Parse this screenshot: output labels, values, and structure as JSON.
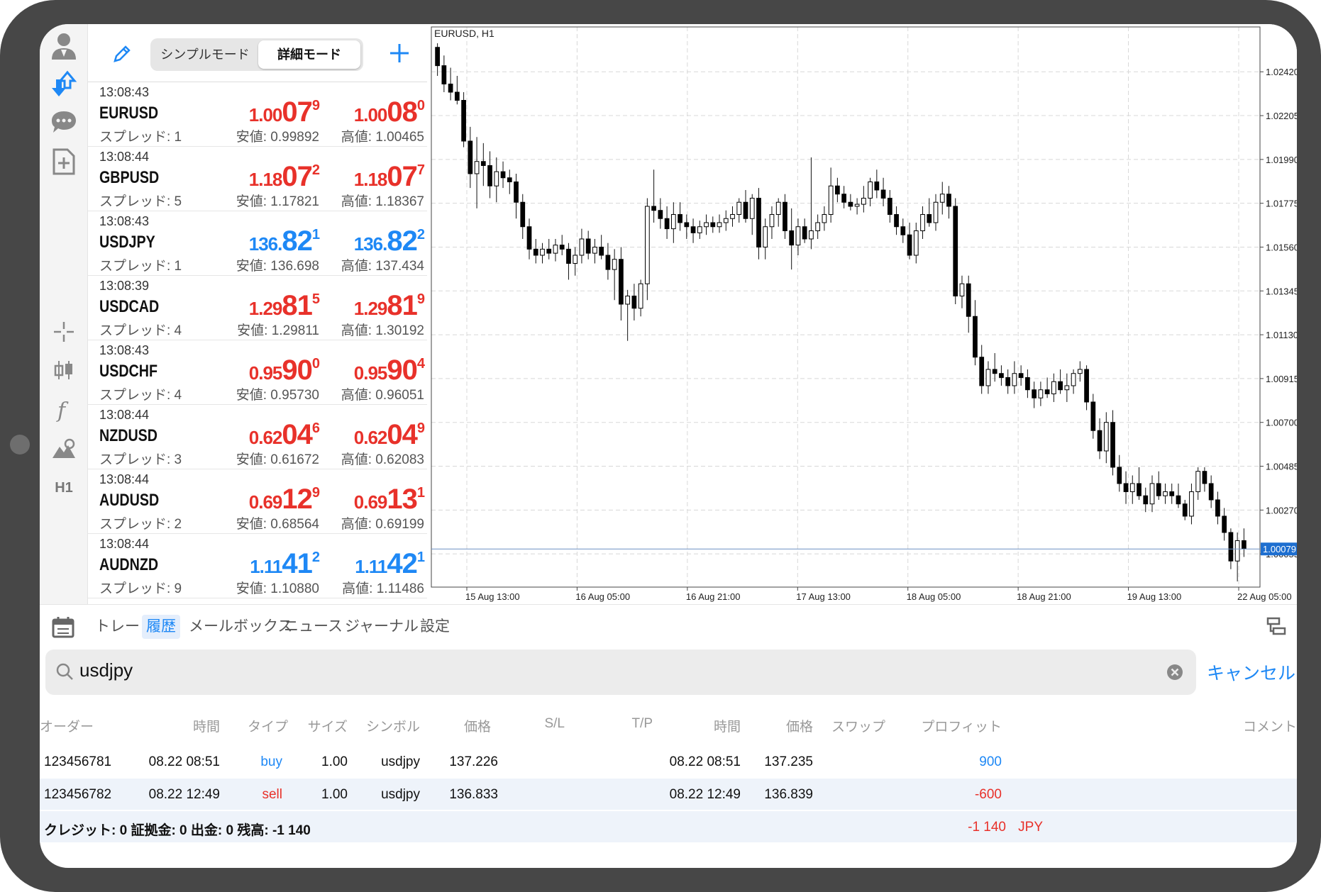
{
  "header": {
    "mode_simple": "シンプルモード",
    "mode_detail": "詳細モード"
  },
  "quotes": [
    {
      "time": "13:08:43",
      "symbol": "EURUSD",
      "spread": "スプレッド: 1",
      "bid": {
        "s": "1.00",
        "b": "07",
        "p": "9"
      },
      "ask": {
        "s": "1.00",
        "b": "08",
        "p": "0"
      },
      "color": "red",
      "low": "安値: 0.99892",
      "high": "高値: 1.00465"
    },
    {
      "time": "13:08:44",
      "symbol": "GBPUSD",
      "spread": "スプレッド: 5",
      "bid": {
        "s": "1.18",
        "b": "07",
        "p": "2"
      },
      "ask": {
        "s": "1.18",
        "b": "07",
        "p": "7"
      },
      "color": "red",
      "low": "安値: 1.17821",
      "high": "高値: 1.18367"
    },
    {
      "time": "13:08:43",
      "symbol": "USDJPY",
      "spread": "スプレッド: 1",
      "bid": {
        "s": "136.",
        "b": "82",
        "p": "1"
      },
      "ask": {
        "s": "136.",
        "b": "82",
        "p": "2"
      },
      "color": "blue",
      "low": "安値: 136.698",
      "high": "高値: 137.434"
    },
    {
      "time": "13:08:39",
      "symbol": "USDCAD",
      "spread": "スプレッド: 4",
      "bid": {
        "s": "1.29",
        "b": "81",
        "p": "5"
      },
      "ask": {
        "s": "1.29",
        "b": "81",
        "p": "9"
      },
      "color": "red",
      "low": "安値: 1.29811",
      "high": "高値: 1.30192"
    },
    {
      "time": "13:08:43",
      "symbol": "USDCHF",
      "spread": "スプレッド: 4",
      "bid": {
        "s": "0.95",
        "b": "90",
        "p": "0"
      },
      "ask": {
        "s": "0.95",
        "b": "90",
        "p": "4"
      },
      "color": "red",
      "low": "安値: 0.95730",
      "high": "高値: 0.96051"
    },
    {
      "time": "13:08:44",
      "symbol": "NZDUSD",
      "spread": "スプレッド: 3",
      "bid": {
        "s": "0.62",
        "b": "04",
        "p": "6"
      },
      "ask": {
        "s": "0.62",
        "b": "04",
        "p": "9"
      },
      "color": "red",
      "low": "安値: 0.61672",
      "high": "高値: 0.62083"
    },
    {
      "time": "13:08:44",
      "symbol": "AUDUSD",
      "spread": "スプレッド: 2",
      "bid": {
        "s": "0.69",
        "b": "12",
        "p": "9"
      },
      "ask": {
        "s": "0.69",
        "b": "13",
        "p": "1"
      },
      "color": "red",
      "low": "安値: 0.68564",
      "high": "高値: 0.69199"
    },
    {
      "time": "13:08:44",
      "symbol": "AUDNZD",
      "spread": "スプレッド: 9",
      "bid": {
        "s": "1.11",
        "b": "41",
        "p": "2"
      },
      "ask": {
        "s": "1.11",
        "b": "42",
        "p": "1"
      },
      "color": "blue",
      "low": "安値: 1.10880",
      "high": "高値: 1.11486"
    }
  ],
  "chart_data": {
    "type": "candlestick",
    "title": "EURUSD, H1",
    "current_price": "1.00079",
    "y_ticks": [
      "1.02420",
      "1.02205",
      "1.01990",
      "1.01775",
      "1.01560",
      "1.01345",
      "1.01130",
      "1.00915",
      "1.00700",
      "1.00485",
      "1.00270",
      "1.00055"
    ],
    "x_ticks": [
      "15 Aug 13:00",
      "16 Aug 05:00",
      "16 Aug 21:00",
      "17 Aug 13:00",
      "18 Aug 05:00",
      "18 Aug 21:00",
      "19 Aug 13:00",
      "22 Aug 05:00"
    ],
    "ylim": [
      0.99892,
      1.0264
    ],
    "candles": [
      [
        1.0254,
        1.0256,
        1.024,
        1.0245
      ],
      [
        1.0245,
        1.025,
        1.0232,
        1.0236
      ],
      [
        1.0236,
        1.0244,
        1.0228,
        1.0232
      ],
      [
        1.0232,
        1.024,
        1.0226,
        1.0228
      ],
      [
        1.0228,
        1.0232,
        1.0205,
        1.0208
      ],
      [
        1.0208,
        1.0215,
        1.0185,
        1.0192
      ],
      [
        1.0192,
        1.021,
        1.0175,
        1.0198
      ],
      [
        1.0198,
        1.0207,
        1.0186,
        1.0196
      ],
      [
        1.0196,
        1.0203,
        1.018,
        1.0186
      ],
      [
        1.0186,
        1.02,
        1.0178,
        1.0193
      ],
      [
        1.0193,
        1.0198,
        1.0185,
        1.019
      ],
      [
        1.019,
        1.0194,
        1.0182,
        1.0188
      ],
      [
        1.0188,
        1.0192,
        1.017,
        1.0178
      ],
      [
        1.0178,
        1.0182,
        1.016,
        1.0166
      ],
      [
        1.0166,
        1.017,
        1.015,
        1.0155
      ],
      [
        1.0155,
        1.016,
        1.0148,
        1.0152
      ],
      [
        1.0152,
        1.0158,
        1.0148,
        1.0155
      ],
      [
        1.0155,
        1.016,
        1.015,
        1.0153
      ],
      [
        1.0153,
        1.016,
        1.0149,
        1.0157
      ],
      [
        1.0157,
        1.0162,
        1.0152,
        1.0155
      ],
      [
        1.0155,
        1.0158,
        1.014,
        1.0148
      ],
      [
        1.0148,
        1.0156,
        1.0142,
        1.0152
      ],
      [
        1.0152,
        1.0165,
        1.0148,
        1.016
      ],
      [
        1.016,
        1.0164,
        1.015,
        1.0153
      ],
      [
        1.0153,
        1.016,
        1.0148,
        1.0156
      ],
      [
        1.0156,
        1.0162,
        1.015,
        1.0152
      ],
      [
        1.0152,
        1.0158,
        1.014,
        1.0145
      ],
      [
        1.0145,
        1.0155,
        1.013,
        1.015
      ],
      [
        1.015,
        1.0156,
        1.012,
        1.0128
      ],
      [
        1.0128,
        1.0135,
        1.011,
        1.0132
      ],
      [
        1.0132,
        1.0138,
        1.012,
        1.0126
      ],
      [
        1.0126,
        1.014,
        1.0122,
        1.0138
      ],
      [
        1.0138,
        1.018,
        1.013,
        1.0176
      ],
      [
        1.0176,
        1.0194,
        1.0168,
        1.0174
      ],
      [
        1.0174,
        1.018,
        1.0165,
        1.017
      ],
      [
        1.017,
        1.0176,
        1.016,
        1.0165
      ],
      [
        1.0165,
        1.0178,
        1.0158,
        1.0172
      ],
      [
        1.0172,
        1.0178,
        1.0164,
        1.0168
      ],
      [
        1.0168,
        1.0172,
        1.016,
        1.0166
      ],
      [
        1.0166,
        1.017,
        1.0158,
        1.0163
      ],
      [
        1.0163,
        1.0169,
        1.016,
        1.0166
      ],
      [
        1.0166,
        1.0172,
        1.0162,
        1.0168
      ],
      [
        1.0168,
        1.0171,
        1.0163,
        1.0166
      ],
      [
        1.0166,
        1.0172,
        1.0163,
        1.0168
      ],
      [
        1.0168,
        1.0174,
        1.0164,
        1.017
      ],
      [
        1.017,
        1.0176,
        1.0166,
        1.0172
      ],
      [
        1.0172,
        1.018,
        1.0168,
        1.0178
      ],
      [
        1.0178,
        1.0184,
        1.0168,
        1.017
      ],
      [
        1.017,
        1.0182,
        1.0162,
        1.018
      ],
      [
        1.018,
        1.0185,
        1.015,
        1.0156
      ],
      [
        1.0156,
        1.017,
        1.015,
        1.0166
      ],
      [
        1.0166,
        1.0176,
        1.016,
        1.0172
      ],
      [
        1.0172,
        1.018,
        1.0166,
        1.0178
      ],
      [
        1.0178,
        1.0182,
        1.016,
        1.0164
      ],
      [
        1.0164,
        1.0175,
        1.0145,
        1.0157
      ],
      [
        1.0157,
        1.017,
        1.0152,
        1.0166
      ],
      [
        1.0166,
        1.017,
        1.0158,
        1.016
      ],
      [
        1.016,
        1.02,
        1.0155,
        1.0164
      ],
      [
        1.0164,
        1.0172,
        1.016,
        1.0168
      ],
      [
        1.0168,
        1.0176,
        1.0164,
        1.0172
      ],
      [
        1.0172,
        1.0195,
        1.0168,
        1.0186
      ],
      [
        1.0186,
        1.019,
        1.0178,
        1.0182
      ],
      [
        1.0182,
        1.0186,
        1.0175,
        1.0178
      ],
      [
        1.0178,
        1.0182,
        1.0174,
        1.0176
      ],
      [
        1.0176,
        1.018,
        1.0172,
        1.0177
      ],
      [
        1.0177,
        1.0186,
        1.0173,
        1.018
      ],
      [
        1.018,
        1.019,
        1.0176,
        1.0188
      ],
      [
        1.0188,
        1.0194,
        1.018,
        1.0184
      ],
      [
        1.0184,
        1.019,
        1.0176,
        1.018
      ],
      [
        1.018,
        1.0184,
        1.0168,
        1.0172
      ],
      [
        1.0172,
        1.0176,
        1.0162,
        1.0166
      ],
      [
        1.0166,
        1.017,
        1.0158,
        1.0162
      ],
      [
        1.0162,
        1.0168,
        1.015,
        1.0152
      ],
      [
        1.0152,
        1.0168,
        1.0148,
        1.0164
      ],
      [
        1.0164,
        1.0176,
        1.016,
        1.0172
      ],
      [
        1.0172,
        1.018,
        1.0166,
        1.0168
      ],
      [
        1.0168,
        1.0182,
        1.0164,
        1.0178
      ],
      [
        1.0178,
        1.0188,
        1.0172,
        1.0182
      ],
      [
        1.0182,
        1.0186,
        1.017,
        1.0176
      ],
      [
        1.0176,
        1.018,
        1.0128,
        1.0132
      ],
      [
        1.0132,
        1.0142,
        1.0126,
        1.0138
      ],
      [
        1.0138,
        1.0142,
        1.0114,
        1.0122
      ],
      [
        1.0122,
        1.013,
        1.0098,
        1.0102
      ],
      [
        1.0102,
        1.0108,
        1.0084,
        1.0088
      ],
      [
        1.0088,
        1.01,
        1.0084,
        1.0096
      ],
      [
        1.0096,
        1.0104,
        1.009,
        1.0094
      ],
      [
        1.0094,
        1.0098,
        1.0088,
        1.0092
      ],
      [
        1.0092,
        1.0096,
        1.0084,
        1.0088
      ],
      [
        1.0088,
        1.01,
        1.0084,
        1.0094
      ],
      [
        1.0094,
        1.0098,
        1.0088,
        1.0092
      ],
      [
        1.0092,
        1.0096,
        1.0082,
        1.0086
      ],
      [
        1.0086,
        1.009,
        1.0077,
        1.0082
      ],
      [
        1.0082,
        1.009,
        1.0078,
        1.0086
      ],
      [
        1.0086,
        1.0092,
        1.0082,
        1.0084
      ],
      [
        1.0084,
        1.0094,
        1.008,
        1.009
      ],
      [
        1.009,
        1.0096,
        1.0084,
        1.0086
      ],
      [
        1.0086,
        1.0094,
        1.008,
        1.0088
      ],
      [
        1.0088,
        1.0096,
        1.0084,
        1.0094
      ],
      [
        1.0094,
        1.01,
        1.009,
        1.0096
      ],
      [
        1.0096,
        1.0098,
        1.0076,
        1.008
      ],
      [
        1.008,
        1.0084,
        1.0062,
        1.0066
      ],
      [
        1.0066,
        1.0072,
        1.0052,
        1.0056
      ],
      [
        1.0056,
        1.0075,
        1.005,
        1.007
      ],
      [
        1.007,
        1.0076,
        1.0044,
        1.0048
      ],
      [
        1.0048,
        1.0054,
        1.0036,
        1.004
      ],
      [
        1.004,
        1.0046,
        1.003,
        1.0036
      ],
      [
        1.0036,
        1.0044,
        1.003,
        1.004
      ],
      [
        1.004,
        1.0048,
        1.0032,
        1.0034
      ],
      [
        1.0034,
        1.0038,
        1.0026,
        1.003
      ],
      [
        1.003,
        1.0044,
        1.0026,
        1.004
      ],
      [
        1.004,
        1.0046,
        1.0032,
        1.0034
      ],
      [
        1.0034,
        1.004,
        1.003,
        1.0036
      ],
      [
        1.0036,
        1.004,
        1.003,
        1.0034
      ],
      [
        1.0034,
        1.004,
        1.0028,
        1.003
      ],
      [
        1.003,
        1.0032,
        1.0022,
        1.0024
      ],
      [
        1.0024,
        1.004,
        1.002,
        1.0036
      ],
      [
        1.0036,
        1.0048,
        1.0032,
        1.0046
      ],
      [
        1.0046,
        1.0048,
        1.0036,
        1.004
      ],
      [
        1.004,
        1.0044,
        1.0028,
        1.0032
      ],
      [
        1.0032,
        1.0036,
        1.002,
        1.0024
      ],
      [
        1.0024,
        1.0028,
        1.0012,
        1.0016
      ],
      [
        1.0016,
        1.0018,
        0.9998,
        1.0002
      ],
      [
        1.0002,
        1.0016,
        0.9992,
        1.0012
      ],
      [
        1.0012,
        1.0018,
        1.0004,
        1.0008
      ]
    ]
  },
  "tabs": [
    "トレード",
    "履歴",
    "メールボックス",
    "ニュース",
    "ジャーナル",
    "設定"
  ],
  "search": {
    "query": "usdjpy",
    "cancel": "キャンセル"
  },
  "history": {
    "headers": [
      "オーダー",
      "時間",
      "タイプ",
      "サイズ",
      "シンボル",
      "価格",
      "S/L",
      "T/P",
      "時間",
      "価格",
      "スワップ",
      "プロフィット",
      "コメント"
    ],
    "rows": [
      {
        "order": "123456781",
        "time": "08.22 08:51",
        "type": "buy",
        "size": "1.00",
        "symbol": "usdjpy",
        "price": "137.226",
        "time2": "08.22 08:51",
        "price2": "137.235",
        "profit": "900"
      },
      {
        "order": "123456782",
        "time": "08.22 12:49",
        "type": "sell",
        "size": "1.00",
        "symbol": "usdjpy",
        "price": "136.833",
        "time2": "08.22 12:49",
        "price2": "136.839",
        "profit": "-600"
      }
    ],
    "summary": "クレジット: 0 証拠金: 0 出金: 0 残高: -1 140",
    "total": "-1 140",
    "currency": "JPY"
  },
  "colors": {
    "up": "#1e88f5",
    "down": "#e8312a",
    "active_tab_bg": "#e4eefc"
  },
  "icons": [
    "user-icon",
    "trade-arrows-icon",
    "chat-icon",
    "add-document-icon",
    "crosshair-icon",
    "candles-icon",
    "function-icon",
    "objects-icon",
    "pencil-icon",
    "plus-icon",
    "calendar-icon",
    "layout-icon",
    "search-icon",
    "clear-icon"
  ],
  "timeframe": "H1"
}
